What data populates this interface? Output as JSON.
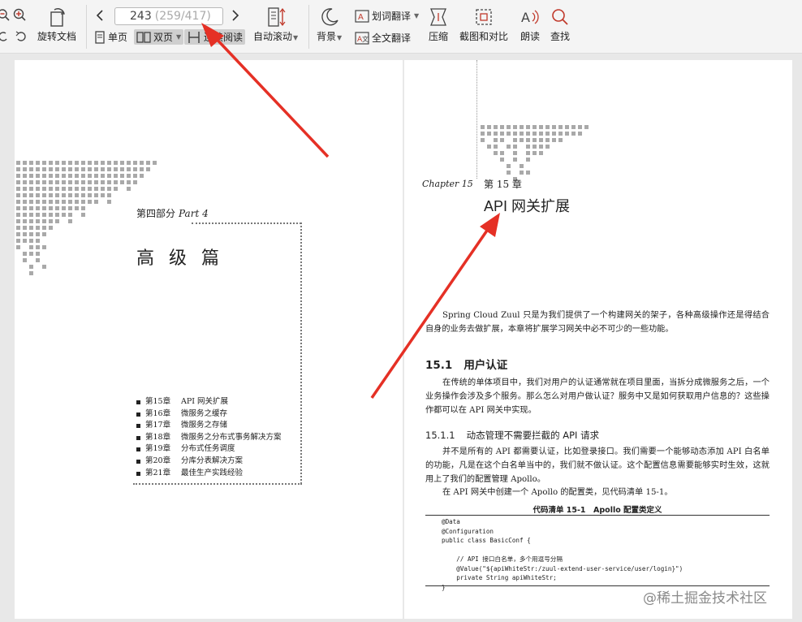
{
  "toolbar": {
    "rotate_doc": "旋转文档",
    "page_current": "243",
    "page_total": "(259/417)",
    "single_page": "单页",
    "double_page": "双页",
    "continuous_read": "连续阅读",
    "auto_scroll": "自动滚动",
    "background": "背景",
    "word_translate": "划词翻译",
    "full_translate": "全文翻译",
    "compress": "压缩",
    "screenshot_compare": "截图和对比",
    "read_aloud": "朗读",
    "search": "查找"
  },
  "left_page": {
    "part_label": "第四部分",
    "part_script": "Part 4",
    "part_title": "高级篇",
    "toc": [
      {
        "num": "第15章",
        "title": "API 网关扩展"
      },
      {
        "num": "第16章",
        "title": "微服务之缓存"
      },
      {
        "num": "第17章",
        "title": "微服务之存储"
      },
      {
        "num": "第18章",
        "title": "微服务之分布式事务解决方案"
      },
      {
        "num": "第19章",
        "title": "分布式任务调度"
      },
      {
        "num": "第20章",
        "title": "分库分表解决方案"
      },
      {
        "num": "第21章",
        "title": "最佳生产实践经验"
      }
    ]
  },
  "right_page": {
    "chapter_script": "Chapter 15",
    "chapter_num": "第 15 章",
    "chapter_title": "API 网关扩展",
    "intro": "Spring Cloud Zuul 只是为我们提供了一个构建网关的架子，各种高级操作还是得结合自身的业务去做扩展，本章将扩展学习网关中必不可少的一些功能。",
    "s1_num": "15.1",
    "s1_title": "用户认证",
    "s1_para": "在传统的单体项目中，我们对用户的认证通常就在项目里面，当拆分成微服务之后，一个业务操作会涉及多个服务。那么怎么对用户做认证？服务中又是如何获取用户信息的？这些操作都可以在 API 网关中实现。",
    "s11_num": "15.1.1",
    "s11_title": "动态管理不需要拦截的 API 请求",
    "s11_para1": "并不是所有的 API 都需要认证，比如登录接口。我们需要一个能够动态添加 API 白名单的功能，凡是在这个白名单当中的，我们就不做认证。这个配置信息需要能够实时生效，这就用上了我们的配置管理 Apollo。",
    "s11_para2": "在 API 网关中创建一个 Apollo 的配置类，见代码清单 15-1。",
    "code_caption": "代码清单 15-1　Apollo 配置类定义",
    "code": "@Data\n@Configuration\npublic class BasicConf {\n\n    // API 接口白名单，多个用逗号分隔\n    @Value(\"${apiWhiteStr:/zuul-extend-user-service/user/login}\")\n    private String apiWhiteStr;\n}"
  },
  "watermark": "@稀土掘金技术社区",
  "colors": {
    "arrow": "#e53025",
    "pixel_pattern": "#a9a9a9",
    "toolbar_bg": "#f4f4f4",
    "viewer_bg": "#e8e8e8"
  }
}
